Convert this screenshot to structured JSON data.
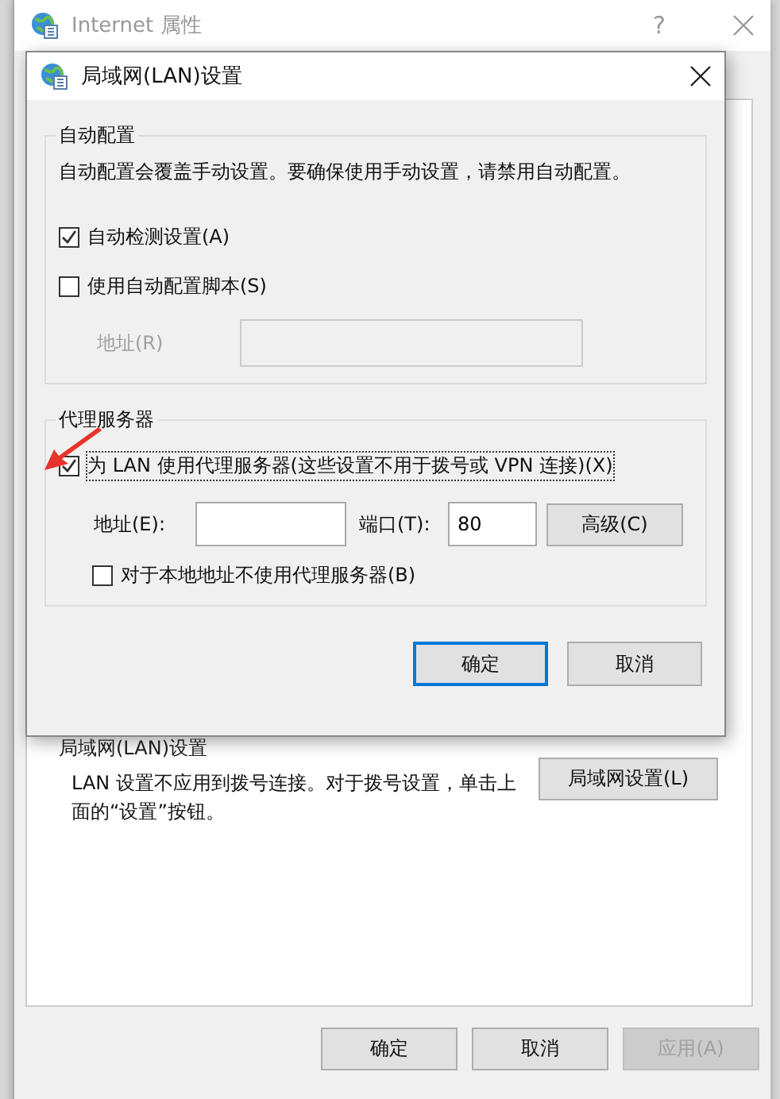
{
  "window": {
    "title": "Internet 属性",
    "help": "?"
  },
  "lan_section": {
    "title": "局域网(LAN)设置",
    "description": "LAN 设置不应用到拨号连接。对于拨号设置，单击上面的“设置”按钮。",
    "button": "局域网设置(L)"
  },
  "buttons": [
    {
      "label": "确定",
      "disabled": false
    },
    {
      "label": "取消",
      "disabled": false
    },
    {
      "label": "应用(A)",
      "disabled": true
    }
  ],
  "dialog": {
    "title": "局域网(LAN)设置",
    "auto_config": {
      "title": "自动配置",
      "description": "自动配置会覆盖手动设置。要确保使用手动设置，请禁用自动配置。",
      "options": [
        {
          "label": "自动检测设置(A)",
          "checked": true
        },
        {
          "label": "使用自动配置脚本(S)",
          "checked": false
        }
      ],
      "address": {
        "label": "地址(R)",
        "disabled": true
      }
    },
    "proxy": {
      "title": "代理服务器",
      "use_proxy": {
        "label": "为 LAN 使用代理服务器(这些设置不用于拨号或 VPN 连接)(X)",
        "checked": true,
        "focused": true
      },
      "address_label": "地址(E):",
      "port_label": "端口(T):",
      "port_value": "80",
      "advanced_button": "高级(C)",
      "bypass": {
        "label": "对于本地地址不使用代理服务器(B)",
        "checked": false
      }
    },
    "buttons": [
      {
        "label": "确定",
        "default": true
      },
      {
        "label": "取消",
        "default": false
      }
    ]
  }
}
